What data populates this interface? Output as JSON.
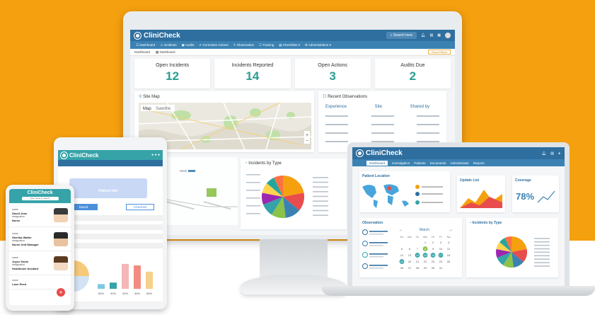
{
  "monitor": {
    "app_name": "CliniCheck",
    "search": "Search here",
    "nav": [
      "Dashboard",
      "Incidents",
      "Audits",
      "Corrective Actions",
      "Observation",
      "Training",
      "Checklists",
      "Administration"
    ],
    "breadcrumb": [
      "Dashboard",
      "Dashboard"
    ],
    "filter_button": "Show Filters",
    "stats": [
      {
        "label": "Open Incidents",
        "value": "12"
      },
      {
        "label": "Incidents Reported",
        "value": "14"
      },
      {
        "label": "Open Actions",
        "value": "3"
      },
      {
        "label": "Audits Due",
        "value": "2"
      }
    ],
    "site_map": {
      "title": "Site Map",
      "tab_map": "Map",
      "tab_satellite": "Satellite"
    },
    "observations": {
      "title": "Recent Observations",
      "columns": [
        "Experience",
        "Site",
        "Shared by"
      ]
    },
    "incidents_by_type": "Incidents by Type"
  },
  "laptop": {
    "app_name": "CliniCheck",
    "nav": [
      "Dashboard",
      "Investigation",
      "Patients",
      "Documents",
      "Administrator",
      "Reports"
    ],
    "patient_location": "Patient Location",
    "update_list": "Update List",
    "coverage": "Coverage",
    "coverage_value": "78%",
    "observation": "Observation",
    "month": "March",
    "weekdays": [
      "Su",
      "Mo",
      "Tu",
      "We",
      "Th",
      "Fr",
      "Sa"
    ],
    "days": [
      "1",
      "2",
      "3",
      "4",
      "5",
      "6",
      "7",
      "8",
      "9",
      "10",
      "11",
      "12",
      "13",
      "14",
      "15",
      "16",
      "17",
      "18",
      "19",
      "20",
      "21",
      "22",
      "23",
      "24",
      "25",
      "26",
      "27",
      "28",
      "29",
      "30",
      "31"
    ],
    "incidents_by_type": "Incidents by Type"
  },
  "tablet": {
    "app_name": "CliniCheck",
    "patient_info": "Patient Info",
    "tab_saved": "Saved",
    "tab_checklist": "Checklist",
    "bar_labels": [
      "80%",
      "90%",
      "40%",
      "35%",
      "56%"
    ]
  },
  "phone": {
    "app_name": "CliniCheck",
    "search": "Type name to search",
    "people": [
      {
        "name_label": "name",
        "name": "David Jean",
        "role_label": "designation",
        "role": "Nurse"
      },
      {
        "name_label": "name",
        "name": "Sherika Watler",
        "role_label": "designation",
        "role": "Nurse Unit Manager"
      },
      {
        "name_label": "name",
        "name": "Joyce Davis",
        "role_label": "designation",
        "role": "Healthcare Assitant"
      },
      {
        "name_label": "name",
        "name": "Lane Reed",
        "role_label": "",
        "role": ""
      }
    ]
  },
  "chart_data": [
    {
      "type": "pie",
      "title": "Incidents by Type",
      "values": [
        22,
        14,
        12,
        11,
        10,
        9,
        8,
        7,
        7
      ]
    },
    {
      "type": "bar",
      "title": "",
      "categories": [
        "80%",
        "90%",
        "40%",
        "35%",
        "56%"
      ],
      "values": [
        15,
        20,
        80,
        75,
        55
      ]
    }
  ],
  "colors": {
    "primary": "#2f6f9f",
    "teal": "#35a3a8",
    "accent": "#f5a00f",
    "stat": "#2a9d8f"
  }
}
